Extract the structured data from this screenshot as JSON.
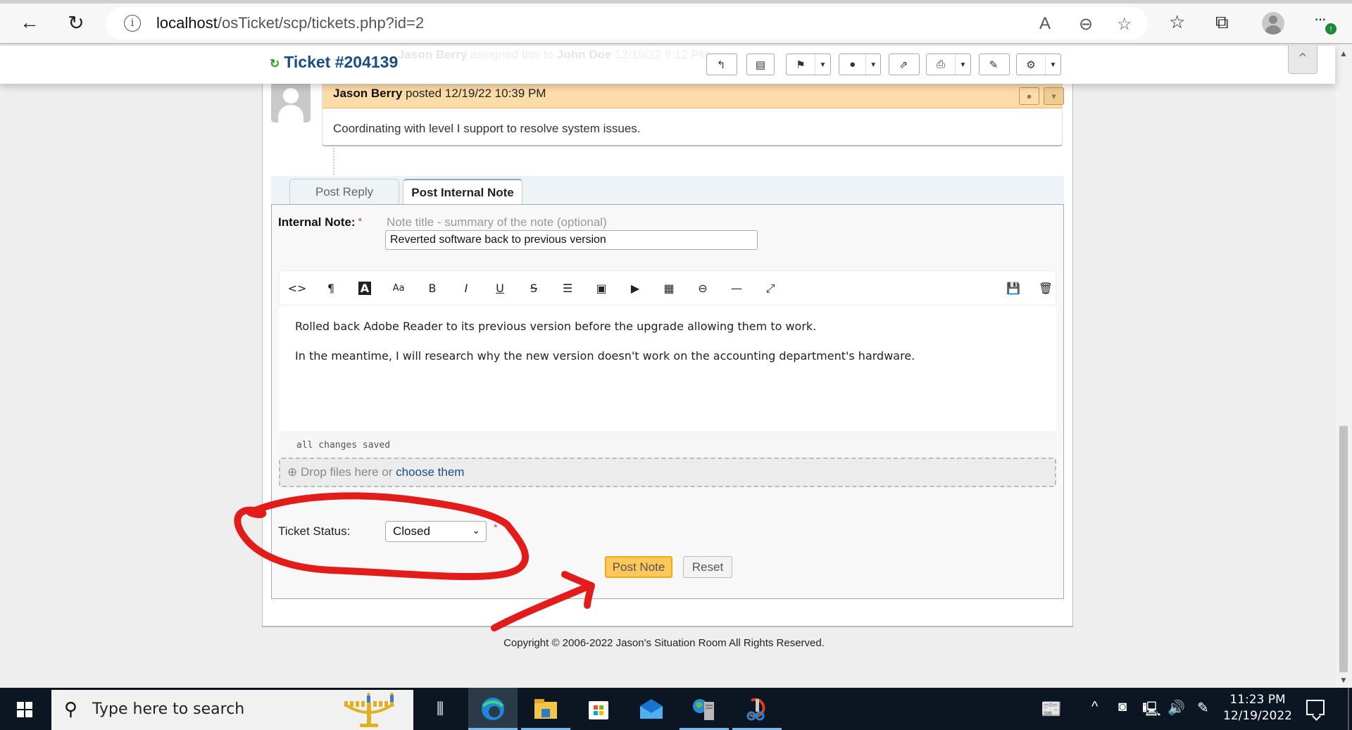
{
  "browser": {
    "url_host": "localhost",
    "url_path": "/osTicket/scp/tickets.php?id=2",
    "icons": [
      "back-icon",
      "refresh-icon",
      "site-info-icon",
      "read-aloud-icon",
      "zoom-out-icon",
      "add-favorite-icon",
      "favorites-icon",
      "collections-icon",
      "profile-icon",
      "more-icon"
    ]
  },
  "header": {
    "ticket_title": "Ticket #204139",
    "ghost_event": {
      "actor": "Jason Berry",
      "action": " assigned this to ",
      "target": "John Doe",
      "time": " 12/19/22 8:12 PM"
    },
    "toolbar": [
      {
        "name": "reply",
        "icon": "↰",
        "dropdown": false
      },
      {
        "name": "edit-note",
        "icon": "▤",
        "dropdown": false
      },
      {
        "name": "flag",
        "icon": "⚑",
        "dropdown": true
      },
      {
        "name": "assign",
        "icon": "●",
        "dropdown": true
      },
      {
        "name": "transfer",
        "icon": "⇗",
        "dropdown": false
      },
      {
        "name": "print",
        "icon": "⎙",
        "dropdown": true
      },
      {
        "name": "edit",
        "icon": "✎",
        "dropdown": false
      },
      {
        "name": "settings",
        "icon": "⚙",
        "dropdown": true
      }
    ]
  },
  "thread": {
    "author": "Jason Berry",
    "action": " posted ",
    "timestamp": "12/19/22 10:39 PM",
    "body": "Coordinating with level I support to resolve system issues."
  },
  "response": {
    "tabs": [
      {
        "label": "Post Reply",
        "active": false
      },
      {
        "label": "Post Internal Note",
        "active": true
      }
    ],
    "note_label": "Internal Note:",
    "required_mark": "*",
    "title_placeholder": "Note title - summary of the note (optional)",
    "title_value": "Reverted software back to previous version",
    "editor_toolbar": [
      "code",
      "paragraph",
      "font-color",
      "font-size",
      "bold",
      "italic",
      "underline",
      "strikethrough",
      "list",
      "image",
      "video",
      "table",
      "link",
      "horizontal-rule",
      "fullscreen",
      "save-draft",
      "delete-draft"
    ],
    "editor_paragraphs": [
      "Rolled back Adobe Reader to its previous version before the upgrade allowing them to work.",
      "In the meantime, I will research why the new version doesn't work on the accounting department's hardware."
    ],
    "editor_status": "all changes saved",
    "dropzone_text": "Drop files here or ",
    "dropzone_link": "choose them",
    "status_label": "Ticket Status:",
    "status_value": "Closed",
    "post_button": "Post Note",
    "reset_button": "Reset"
  },
  "footer": {
    "copyright": "Copyright © 2006-2022 Jason's Situation Room All Rights Reserved."
  },
  "annotations": {
    "color": "#e21b1b",
    "items": [
      "circle around ticket status",
      "arrow pointing to Post Note"
    ]
  },
  "taskbar": {
    "search_placeholder": "Type here to search",
    "apps": [
      "task-view",
      "edge",
      "file-explorer",
      "microsoft-store",
      "mail",
      "iis-manager",
      "snipping-tool"
    ],
    "time": "11:23 PM",
    "date": "12/19/2022"
  }
}
